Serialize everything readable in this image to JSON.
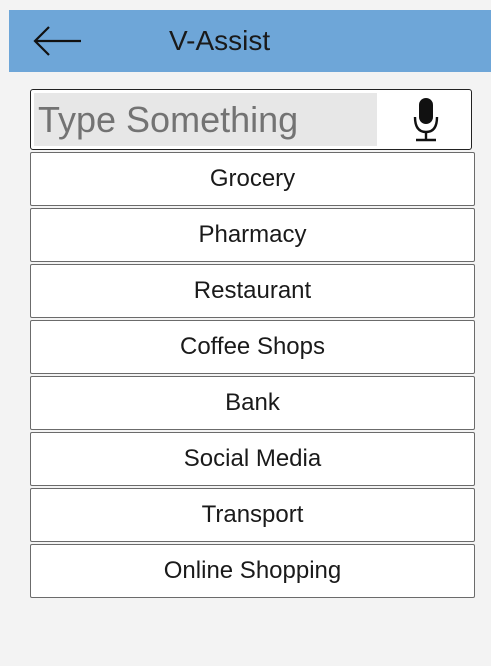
{
  "header": {
    "title": "V-Assist",
    "back_icon": "arrow-left-icon"
  },
  "search": {
    "placeholder": "Type Something",
    "value": "",
    "mic_icon": "microphone-icon"
  },
  "categories": [
    "Grocery",
    "Pharmacy",
    "Restaurant",
    "Coffee Shops",
    "Bank",
    "Social Media",
    "Transport",
    "Online Shopping"
  ],
  "colors": {
    "header_bg": "#6ea6d8",
    "page_bg": "#f3f3f3",
    "input_bg": "#e7e7e7",
    "item_bg": "#ffffff"
  }
}
